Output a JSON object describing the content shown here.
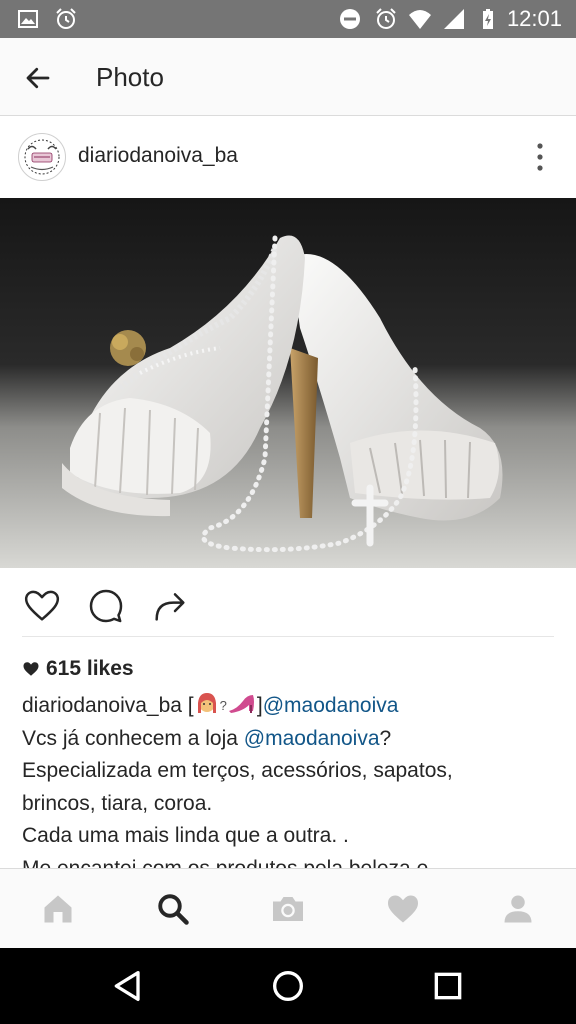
{
  "status_bar": {
    "time": "12:01",
    "left_icons": [
      "image-icon",
      "alarm-icon"
    ],
    "right_icons": [
      "do-not-disturb-icon",
      "alarm-icon",
      "wifi-icon",
      "signal-icon",
      "battery-icon"
    ]
  },
  "app_bar": {
    "title": "Photo"
  },
  "post": {
    "username": "diariodanoiva_ba",
    "likes": "615 likes",
    "caption": {
      "username": "diariodanoiva_ba",
      "open_bracket": " [",
      "placeholder_glyph": "?",
      "close_bracket": "]",
      "mention_1": "@maodanoiva",
      "line2_prefix": "Vcs já conhecem a loja ",
      "mention_2": "@maodanoiva",
      "line2_suffix": "?",
      "line3": "Especializada em terços, acessórios, sapatos,",
      "line4": "brincos, tiara, coroa.",
      "line5": "Cada uma mais linda que a outra. .",
      "line6": "Me encantei com os produtos pela beleza e"
    }
  },
  "actions": [
    "heart-icon",
    "comment-icon",
    "share-icon"
  ],
  "tabs": [
    "home-icon",
    "search-icon",
    "camera-icon",
    "activity-heart-icon",
    "profile-icon"
  ],
  "active_tab": "search-icon",
  "colors": {
    "status_bar": "#757575",
    "app_bar": "#fafafa",
    "mention": "#125688",
    "text": "#262626",
    "inactive_icon": "#c7c7c7",
    "nav_bar": "#000000"
  }
}
